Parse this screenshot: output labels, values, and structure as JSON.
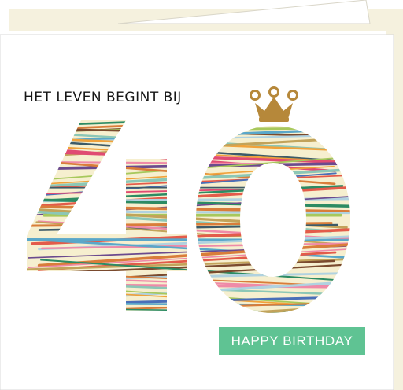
{
  "card": {
    "headline": "HET LEVEN BEGINT BIJ",
    "number": "40",
    "banner": "HAPPY BIRTHDAY"
  },
  "icons": [
    "crown-icon"
  ],
  "colors": {
    "number_fill": "#f6efcf",
    "crown": "#b6883a",
    "banner": "#5fc393",
    "banner_text": "#ffffff",
    "headline_text": "#151515",
    "envelope": "#f5f1de",
    "stripe_palette": [
      "#e35b4a",
      "#2c8b63",
      "#5aa7c9",
      "#f0a23b",
      "#6b4a8e",
      "#ef8aa8",
      "#a7c85c",
      "#3d5a68",
      "#d97d3a",
      "#8cc7b6",
      "#c2a35a",
      "#e04b73",
      "#4a6fb8",
      "#b0d2e0",
      "#7a4a2e"
    ]
  }
}
